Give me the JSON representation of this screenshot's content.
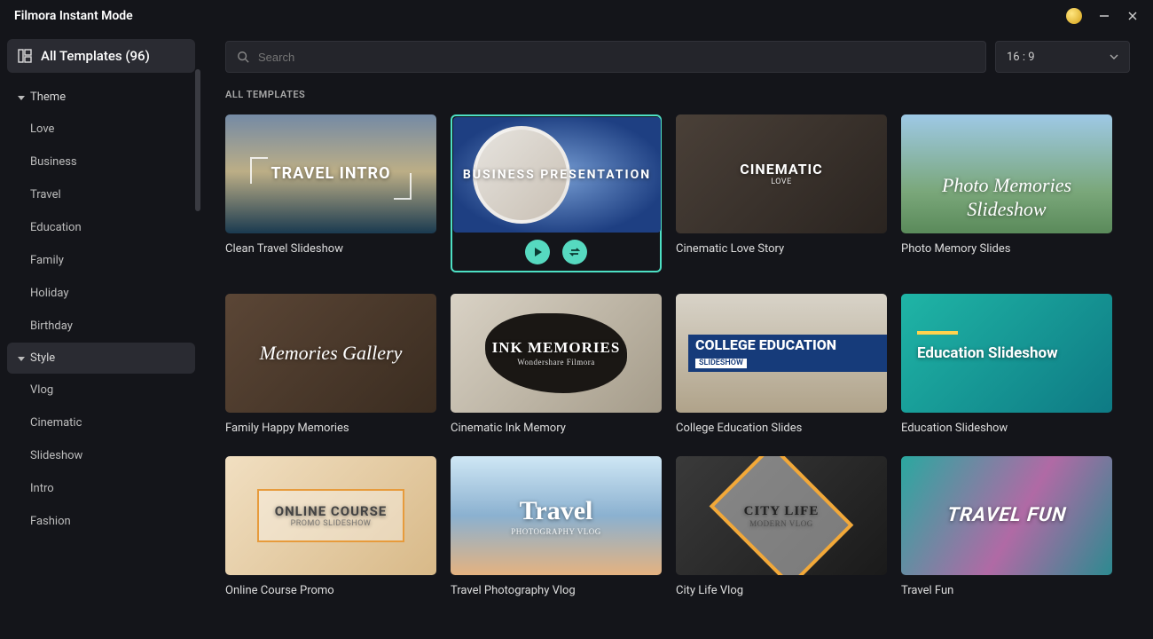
{
  "titlebar": {
    "title": "Filmora Instant Mode"
  },
  "sidebar": {
    "all_templates": "All Templates (96)",
    "theme_label": "Theme",
    "theme_items": [
      "Love",
      "Business",
      "Travel",
      "Education",
      "Family",
      "Holiday",
      "Birthday"
    ],
    "style_label": "Style",
    "style_items": [
      "Vlog",
      "Cinematic",
      "Slideshow",
      "Intro",
      "Fashion"
    ]
  },
  "search": {
    "placeholder": "Search"
  },
  "ratio": {
    "value": "16 : 9"
  },
  "section_title": "ALL TEMPLATES",
  "templates": [
    {
      "label": "Clean Travel Slideshow",
      "overlay_main": "TRAVEL INTRO",
      "overlay_sub": ""
    },
    {
      "label": "Business Presentation",
      "overlay_main": "BUSINESS PRESENTATION",
      "overlay_sub": "",
      "selected": true
    },
    {
      "label": "Cinematic Love Story",
      "overlay_main": "CINEMATIC",
      "overlay_sub": "LOVE"
    },
    {
      "label": "Photo Memory Slides",
      "overlay_main": "Photo Memories Slideshow",
      "overlay_sub": ""
    },
    {
      "label": "Family Happy Memories",
      "overlay_main": "Memories Gallery",
      "overlay_sub": ""
    },
    {
      "label": "Cinematic Ink Memory",
      "overlay_main": "INK MEMORIES",
      "overlay_sub": "Wondershare Filmora"
    },
    {
      "label": "College Education Slides",
      "overlay_main": "COLLEGE EDUCATION",
      "overlay_sub": "SLIDESHOW"
    },
    {
      "label": "Education Slideshow",
      "overlay_main": "Education Slideshow",
      "overlay_sub": ""
    },
    {
      "label": "Online Course Promo",
      "overlay_main": "ONLINE COURSE",
      "overlay_sub": "PROMO SLIDESHOW"
    },
    {
      "label": "Travel Photography Vlog",
      "overlay_main": "Travel",
      "overlay_sub": "PHOTOGRAPHY VLOG"
    },
    {
      "label": "City Life Vlog",
      "overlay_main": "CITY LIFE",
      "overlay_sub": "MODERN VLOG"
    },
    {
      "label": "Travel Fun",
      "overlay_main": "TRAVEL FUN",
      "overlay_sub": ""
    }
  ]
}
